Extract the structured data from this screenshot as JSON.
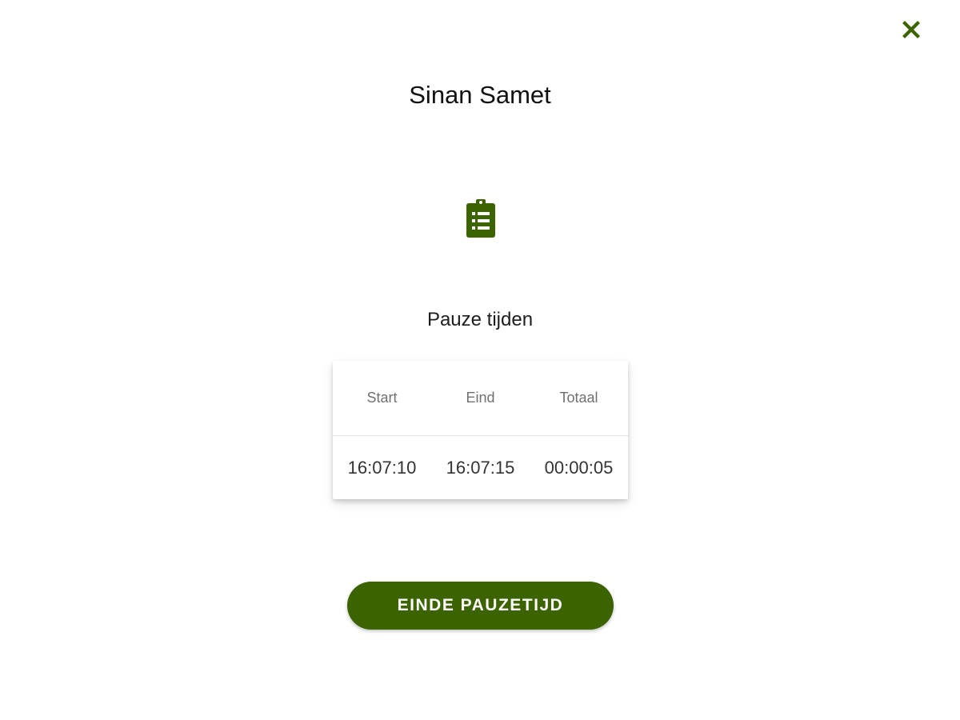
{
  "dialog": {
    "close_icon": "close-icon",
    "title": "Sinan Samet",
    "icon": "clipboard-list-icon",
    "subtitle": "Pauze tijden"
  },
  "pause_table": {
    "headers": [
      "Start",
      "Eind",
      "Totaal"
    ],
    "rows": [
      [
        "16:07:10",
        "16:07:15",
        "00:00:05"
      ]
    ]
  },
  "actions": {
    "end_pause_label": "EINDE PAUZETIJD"
  },
  "colors": {
    "accent": "#3b6300",
    "button_text": "#ffffff"
  }
}
